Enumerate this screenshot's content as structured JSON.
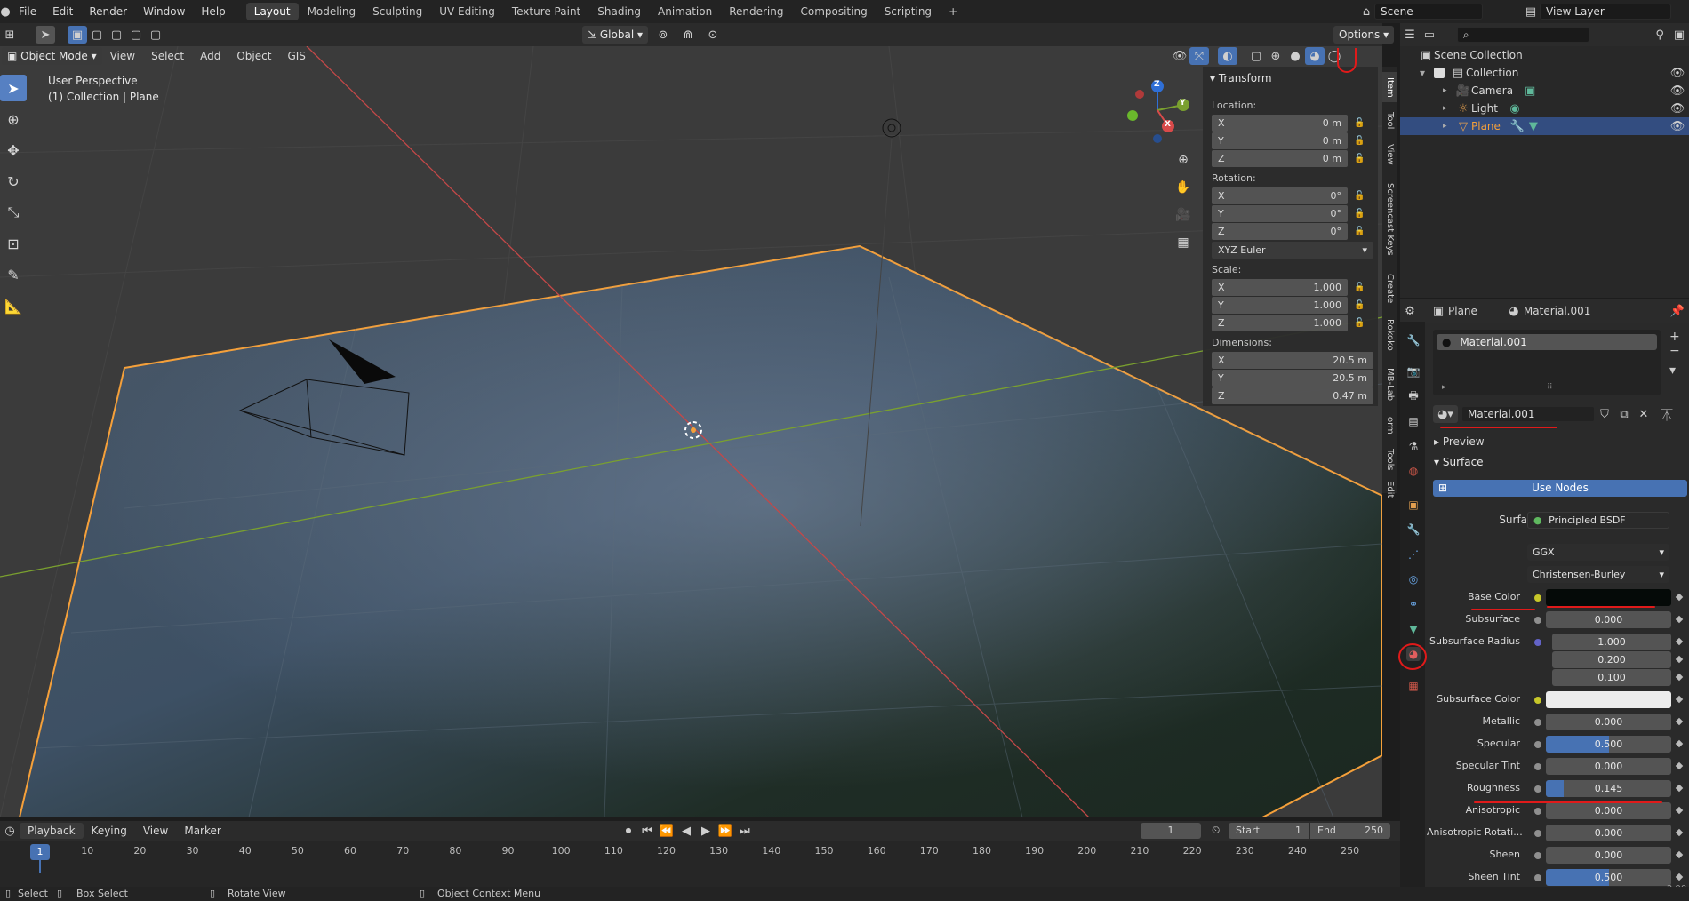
{
  "app": {
    "version": "2.90.1"
  },
  "topbar": {
    "menus": [
      "File",
      "Edit",
      "Render",
      "Window",
      "Help"
    ],
    "workspaces": [
      "Layout",
      "Modeling",
      "Sculpting",
      "UV Editing",
      "Texture Paint",
      "Shading",
      "Animation",
      "Rendering",
      "Compositing",
      "Scripting"
    ],
    "active_workspace": "Layout",
    "add_tab": "+",
    "scene": "Scene",
    "view_layer": "View Layer"
  },
  "viewport_header": {
    "mode": "Object Mode",
    "menus": [
      "View",
      "Select",
      "Add",
      "Object",
      "GIS"
    ],
    "orientation": "Global",
    "options": "Options"
  },
  "viewport": {
    "perspective": "User Perspective",
    "collection_info": "(1) Collection | Plane",
    "gizmo": {
      "x": "X",
      "y": "Y",
      "z": "Z"
    }
  },
  "npanel": {
    "title": "Transform",
    "location_label": "Location:",
    "location": [
      {
        "axis": "X",
        "value": "0 m"
      },
      {
        "axis": "Y",
        "value": "0 m"
      },
      {
        "axis": "Z",
        "value": "0 m"
      }
    ],
    "rotation_label": "Rotation:",
    "rotation": [
      {
        "axis": "X",
        "value": "0°"
      },
      {
        "axis": "Y",
        "value": "0°"
      },
      {
        "axis": "Z",
        "value": "0°"
      }
    ],
    "rotation_mode": "XYZ Euler",
    "scale_label": "Scale:",
    "scale": [
      {
        "axis": "X",
        "value": "1.000"
      },
      {
        "axis": "Y",
        "value": "1.000"
      },
      {
        "axis": "Z",
        "value": "1.000"
      }
    ],
    "dimensions_label": "Dimensions:",
    "dimensions": [
      {
        "axis": "X",
        "value": "20.5 m"
      },
      {
        "axis": "Y",
        "value": "20.5 m"
      },
      {
        "axis": "Z",
        "value": "0.47 m"
      }
    ],
    "tabs": [
      "Item",
      "Tool",
      "View",
      "Screencast Keys",
      "Create",
      "Rokoko",
      "MB-Lab",
      "orm",
      "Tools",
      "Edit"
    ]
  },
  "outliner": {
    "root": "Scene Collection",
    "collection": "Collection",
    "items": [
      "Camera",
      "Light",
      "Plane"
    ],
    "selected": "Plane"
  },
  "properties": {
    "object": "Plane",
    "material": "Material.001",
    "slot": "Material.001",
    "material_field": "Material.001",
    "preview": "Preview",
    "surface_section": "Surface",
    "use_nodes": "Use Nodes",
    "surface_label": "Surface",
    "surface_value": "Principled BSDF",
    "distribution": "GGX",
    "subsurface_method": "Christensen-Burley",
    "params": [
      {
        "label": "Base Color",
        "value": "",
        "type": "color",
        "color": "#050a08"
      },
      {
        "label": "Subsurface",
        "value": "0.000",
        "fill": 0
      },
      {
        "label": "Subsurface Radius",
        "value": "1.000",
        "fill": 0
      },
      {
        "label": "",
        "value": "0.200",
        "fill": 0
      },
      {
        "label": "",
        "value": "0.100",
        "fill": 0
      },
      {
        "label": "Subsurface Color",
        "value": "",
        "type": "color",
        "color": "#ececec"
      },
      {
        "label": "Metallic",
        "value": "0.000",
        "fill": 0
      },
      {
        "label": "Specular",
        "value": "0.500",
        "fill": 0.5
      },
      {
        "label": "Specular Tint",
        "value": "0.000",
        "fill": 0
      },
      {
        "label": "Roughness",
        "value": "0.145",
        "fill": 0.145
      },
      {
        "label": "Anisotropic",
        "value": "0.000",
        "fill": 0
      },
      {
        "label": "Anisotropic Rotati...",
        "value": "0.000",
        "fill": 0
      },
      {
        "label": "Sheen",
        "value": "0.000",
        "fill": 0
      },
      {
        "label": "Sheen Tint",
        "value": "0.500",
        "fill": 0.5
      }
    ]
  },
  "timeline": {
    "menus": [
      "Playback",
      "Keying",
      "View",
      "Marker"
    ],
    "current_frame": "1",
    "start_label": "Start",
    "start": "1",
    "end_label": "End",
    "end": "250",
    "ticks": [
      "1",
      "10",
      "20",
      "30",
      "40",
      "50",
      "60",
      "70",
      "80",
      "90",
      "100",
      "110",
      "120",
      "130",
      "140",
      "150",
      "160",
      "170",
      "180",
      "190",
      "200",
      "210",
      "220",
      "230",
      "240",
      "250"
    ]
  },
  "statusbar": {
    "select": "Select",
    "box_select": "Box Select",
    "rotate_view": "Rotate View",
    "context_menu": "Object Context Menu"
  },
  "colors": {
    "accent": "#4772b3",
    "selection": "#f5a03a",
    "annotation": "#e01a1a"
  }
}
